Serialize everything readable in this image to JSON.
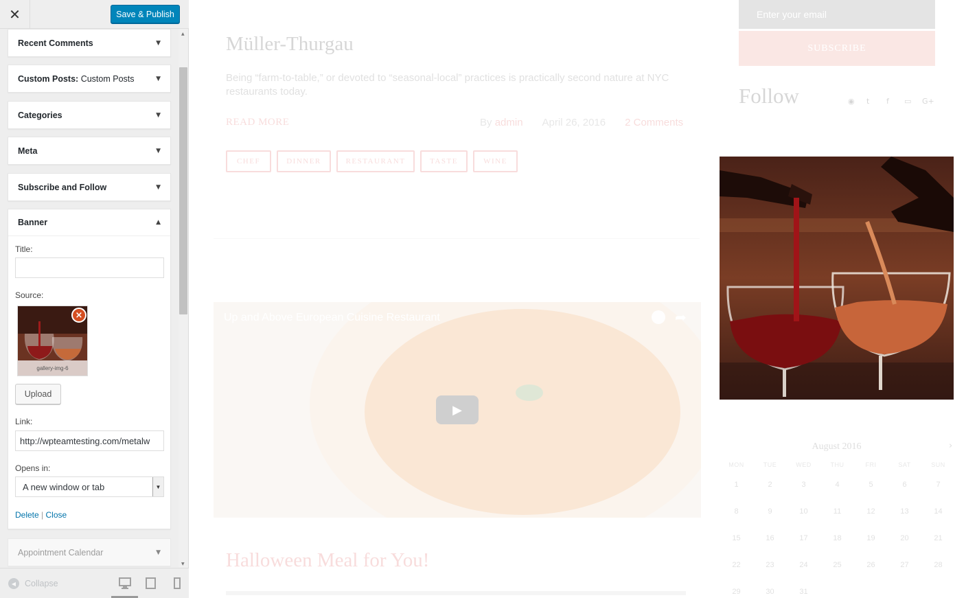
{
  "customizer": {
    "close_label": "✕",
    "publish_label": "Save & Publish",
    "widgets": [
      {
        "title": "Recent Comments",
        "subtitle": ""
      },
      {
        "title": "Custom Posts:",
        "subtitle": "Custom Posts"
      },
      {
        "title": "Categories",
        "subtitle": ""
      },
      {
        "title": "Meta",
        "subtitle": ""
      },
      {
        "title": "Subscribe and Follow",
        "subtitle": ""
      },
      {
        "title": "Banner",
        "subtitle": ""
      },
      {
        "title": "Appointment Calendar",
        "subtitle": ""
      }
    ],
    "banner_form": {
      "title_label": "Title:",
      "title_value": "",
      "source_label": "Source:",
      "source_image_caption": "gallery-img-6",
      "remove_icon": "×",
      "upload_label": "Upload",
      "link_label": "Link:",
      "link_value": "http://wpteamtesting.com/metalw",
      "opens_label": "Opens in:",
      "opens_value": "A new window or tab",
      "delete_label": "Delete",
      "separator": "|",
      "close_label": "Close"
    },
    "footer": {
      "collapse_label": "Collapse",
      "devices": [
        "desktop-icon",
        "tablet-icon",
        "mobile-icon"
      ]
    }
  },
  "preview": {
    "post": {
      "title": "Müller-Thurgau",
      "excerpt": "Being “farm-to-table,” or devoted to “seasonal-local” practices is practically second nature at NYC restaurants today.",
      "read_more": "READ MORE",
      "by_label": "By",
      "author": "admin",
      "date": "April 26, 2016",
      "comments": "2 Comments",
      "tags": [
        "CHEF",
        "DINNER",
        "RESTAURANT",
        "TASTE",
        "WINE"
      ]
    },
    "video": {
      "title": "Up and Above European Cuisine Restaurant"
    },
    "post2": {
      "title": "Halloween Meal for You!"
    },
    "sidebar": {
      "email_placeholder": "Enter your email",
      "subscribe_label": "SUBSCRIBE",
      "follow_title": "Follow",
      "social_icons": [
        "rss-icon",
        "twitter-icon",
        "facebook-icon",
        "youtube-icon",
        "google-plus-icon"
      ],
      "social_glyphs": [
        "◉",
        "t",
        "f",
        "▭",
        "G+"
      ]
    },
    "calendar": {
      "title": "August 2016",
      "next": "›",
      "days_of_week": [
        "MON",
        "TUE",
        "WED",
        "THU",
        "FRI",
        "SAT",
        "SUN"
      ],
      "weeks": [
        [
          "1",
          "2",
          "3",
          "4",
          "5",
          "6",
          "7"
        ],
        [
          "8",
          "9",
          "10",
          "11",
          "12",
          "13",
          "14"
        ],
        [
          "15",
          "16",
          "17",
          "18",
          "19",
          "20",
          "21"
        ],
        [
          "22",
          "23",
          "24",
          "25",
          "26",
          "27",
          "28"
        ],
        [
          "29",
          "30",
          "31",
          "",
          "",
          "",
          ""
        ]
      ]
    }
  },
  "colors": {
    "primary_button": "#0085ba",
    "accent": "#d9534f",
    "link": "#0073aa"
  }
}
